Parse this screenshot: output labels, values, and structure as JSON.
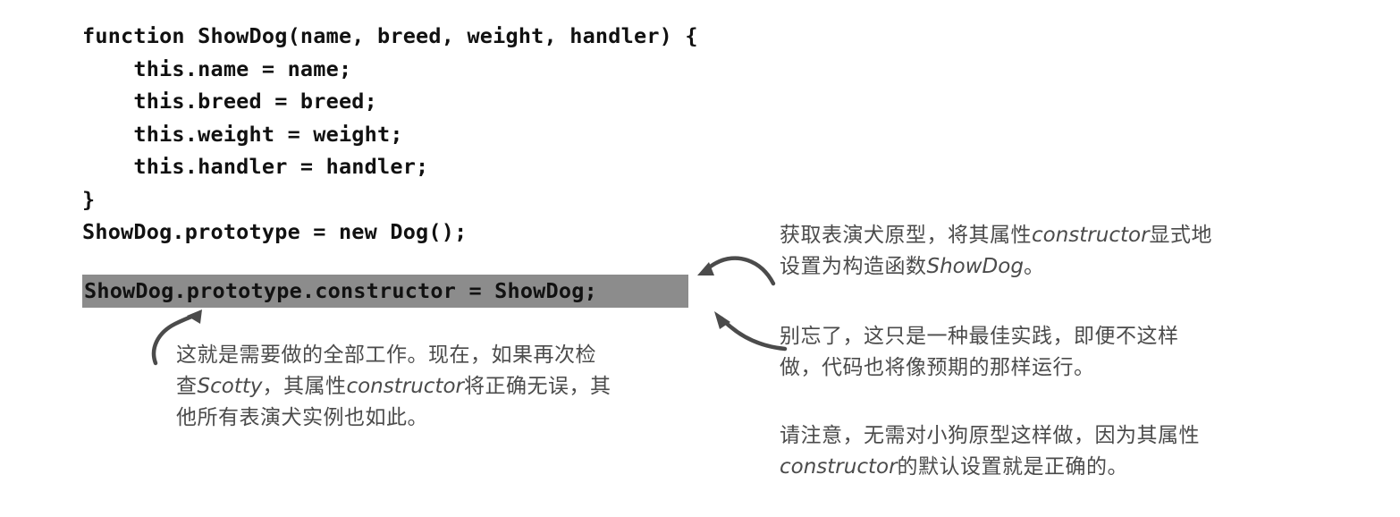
{
  "page": {
    "background": "#ffffff",
    "code_text_color": "#111111",
    "annotation_text_color": "#4b4b4b",
    "highlight_color": "#8c8c8c"
  },
  "code": {
    "lines": [
      "function ShowDog(name, breed, weight, handler) {",
      "    this.name = name;",
      "    this.breed = breed;",
      "    this.weight = weight;",
      "    this.handler = handler;",
      "}",
      "ShowDog.prototype = new Dog();"
    ],
    "highlighted_line": "ShowDog.prototype.constructor = ShowDog;"
  },
  "annotations": {
    "left": {
      "line1": "这就是需要做的全部工作。现在，如果再次检",
      "line2_prefix": "查",
      "line2_italic_a": "Scotty",
      "line2_mid": "，其属性",
      "line2_italic_b": "constructor",
      "line2_suffix": "将正确无误，其",
      "line3": "他所有表演犬实例也如此。"
    },
    "right_1": {
      "line1_prefix": "获取表演犬原型，将其属性",
      "line1_italic": "constructor",
      "line1_suffix": "显式地",
      "line2_prefix": "设置为构造函数",
      "line2_italic": "ShowDog",
      "line2_suffix": "。"
    },
    "right_2": {
      "line1": "别忘了，这只是一种最佳实践，即便不这样",
      "line2": "做，代码也将像预期的那样运行。"
    },
    "right_3": {
      "line1": "请注意，无需对小狗原型这样做，因为其属性",
      "line2_italic": "constructor",
      "line2_suffix": "的默认设置就是正确的。"
    }
  },
  "icons": {
    "arrow_up_left": "curved-arrow-up-icon",
    "arrow_right_top": "curved-arrow-left-icon",
    "arrow_right_mid": "curved-arrow-upleft-icon"
  }
}
